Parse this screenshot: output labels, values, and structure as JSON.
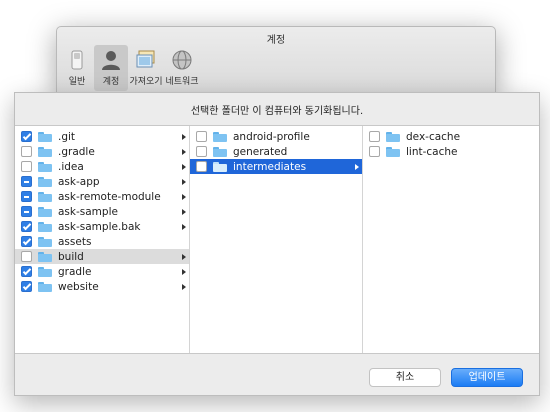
{
  "preferences": {
    "title": "계정",
    "tabs": [
      {
        "label": "일반"
      },
      {
        "label": "계정"
      },
      {
        "label": "가져오기"
      },
      {
        "label": "네트워크"
      }
    ]
  },
  "dialog": {
    "message": "선택한 폴더만 이 컴퓨터와 동기화됩니다.",
    "columns": [
      {
        "items": [
          {
            "name": ".git",
            "state": "checked",
            "has_children": true
          },
          {
            "name": ".gradle",
            "state": "unchecked",
            "has_children": true
          },
          {
            "name": ".idea",
            "state": "unchecked",
            "has_children": true
          },
          {
            "name": "ask-app",
            "state": "mixed",
            "has_children": true
          },
          {
            "name": "ask-remote-module",
            "state": "mixed",
            "has_children": true
          },
          {
            "name": "ask-sample",
            "state": "mixed",
            "has_children": true
          },
          {
            "name": "ask-sample.bak",
            "state": "checked",
            "has_children": true
          },
          {
            "name": "assets",
            "state": "checked",
            "has_children": false
          },
          {
            "name": "build",
            "state": "unchecked",
            "has_children": true,
            "highlight": "gray"
          },
          {
            "name": "gradle",
            "state": "checked",
            "has_children": true
          },
          {
            "name": "website",
            "state": "checked",
            "has_children": true
          }
        ]
      },
      {
        "items": [
          {
            "name": "android-profile",
            "state": "unchecked",
            "has_children": false
          },
          {
            "name": "generated",
            "state": "unchecked",
            "has_children": false
          },
          {
            "name": "intermediates",
            "state": "unchecked",
            "has_children": true,
            "highlight": "blue"
          }
        ]
      },
      {
        "items": [
          {
            "name": "dex-cache",
            "state": "unchecked",
            "has_children": false
          },
          {
            "name": "lint-cache",
            "state": "unchecked",
            "has_children": false
          }
        ]
      }
    ],
    "buttons": {
      "cancel": "취소",
      "update": "업데이트"
    }
  }
}
